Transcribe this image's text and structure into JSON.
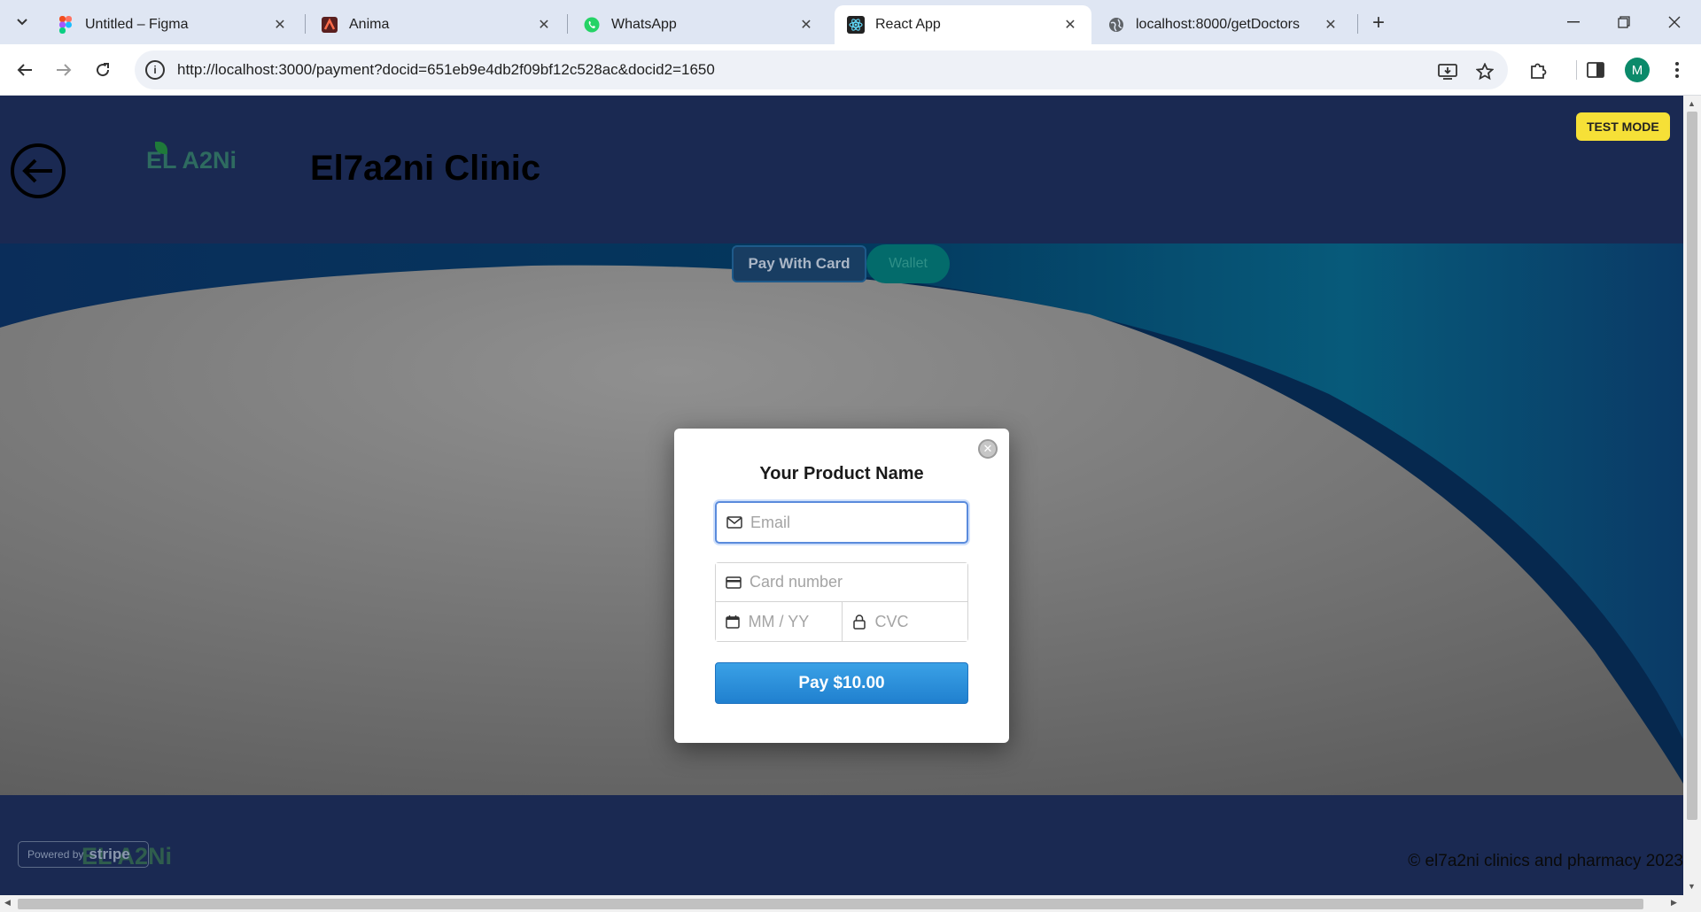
{
  "browser": {
    "tabs": [
      {
        "title": "Untitled – Figma",
        "icon": "figma-icon"
      },
      {
        "title": "Anima",
        "icon": "anima-icon"
      },
      {
        "title": "WhatsApp",
        "icon": "whatsapp-icon"
      },
      {
        "title": "React App",
        "icon": "react-icon",
        "active": true
      },
      {
        "title": "localhost:8000/getDoctors",
        "icon": "globe-icon"
      }
    ],
    "url": "http://localhost:3000/payment?docid=651eb9e4db2f09bf12c528ac&docid2=1650",
    "profile_initial": "M"
  },
  "page": {
    "logo_text": "EL A2Ni",
    "title": "El7a2ni Clinic",
    "test_mode": "TEST MODE",
    "pay_with_card": "Pay With Card",
    "wallet": "Wallet",
    "footer_logo": "EL A2Ni",
    "powered_by": "Powered by",
    "stripe": "stripe",
    "copyright": "© el7a2ni clinics and pharmacy 2023"
  },
  "modal": {
    "title": "Your Product Name",
    "email_placeholder": "Email",
    "card_placeholder": "Card number",
    "expiry_placeholder": "MM / YY",
    "cvc_placeholder": "CVC",
    "pay_button": "Pay $10.00"
  },
  "colors": {
    "header_bg": "#1a2952",
    "test_mode_bg": "#f6e037",
    "pay_button_bg": "#2a8fdc",
    "wallet_bg": "#036b6b"
  }
}
